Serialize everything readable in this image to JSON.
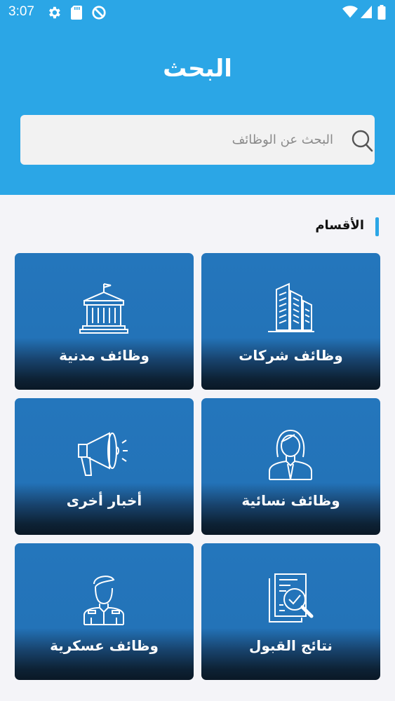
{
  "status_bar": {
    "time": "3:07"
  },
  "header": {
    "title": "البحث"
  },
  "search": {
    "placeholder": "البحث عن الوظائف"
  },
  "sections": {
    "title": "الأقسام"
  },
  "categories": [
    {
      "label": "وظائف شركات",
      "icon": "buildings-icon"
    },
    {
      "label": "وظائف مدنية",
      "icon": "government-building-icon"
    },
    {
      "label": "وظائف نسائية",
      "icon": "woman-icon"
    },
    {
      "label": "أخبار أخرى",
      "icon": "megaphone-icon"
    },
    {
      "label": "نتائج القبول",
      "icon": "document-check-icon"
    },
    {
      "label": "وظائف عسكرية",
      "icon": "soldier-icon"
    }
  ],
  "colors": {
    "header": "#2ba6e6",
    "card": "#2476bc",
    "accent": "#2ba6e6"
  }
}
